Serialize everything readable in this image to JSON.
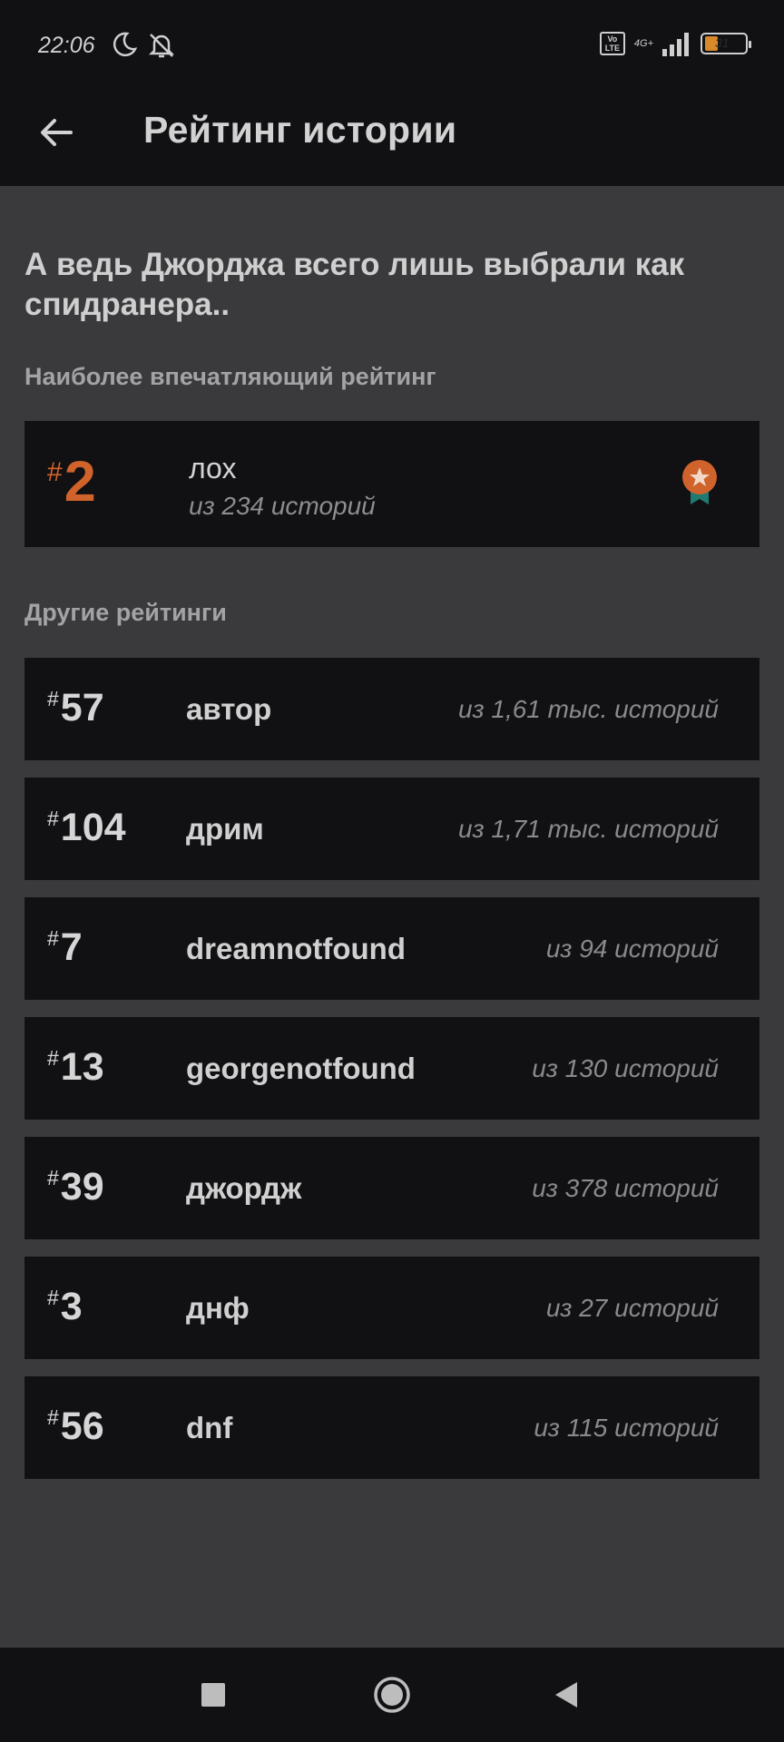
{
  "status_bar": {
    "time": "22:06",
    "volte_label": "Vo LTE",
    "network_label": "4G+",
    "battery_level": "31"
  },
  "app_bar": {
    "title": "Рейтинг истории"
  },
  "story": {
    "title": "А ведь Джорджа всего лишь выбрали как спидранера.."
  },
  "top_ranking": {
    "section_label": "Наиболее впечатляющий рейтинг",
    "hash": "#",
    "rank": "2",
    "tag": "лох",
    "count": "из 234 историй",
    "accent_color": "#d0632b"
  },
  "other_rankings": {
    "section_label": "Другие рейтинги",
    "items": [
      {
        "hash": "#",
        "rank": "57",
        "tag": "автор",
        "count": "из 1,61 тыс. историй"
      },
      {
        "hash": "#",
        "rank": "104",
        "tag": "дрим",
        "count": "из 1,71 тыс. историй"
      },
      {
        "hash": "#",
        "rank": "7",
        "tag": "dreamnotfound",
        "count": "из 94 историй"
      },
      {
        "hash": "#",
        "rank": "13",
        "tag": "georgenotfound",
        "count": "из 130 историй"
      },
      {
        "hash": "#",
        "rank": "39",
        "tag": "джордж",
        "count": "из 378 историй"
      },
      {
        "hash": "#",
        "rank": "3",
        "tag": "днф",
        "count": "из 27 историй"
      },
      {
        "hash": "#",
        "rank": "56",
        "tag": "dnf",
        "count": "из 115 историй"
      }
    ]
  },
  "nav_bar": {
    "buttons": [
      "recents-square-icon",
      "home-circle-icon",
      "back-triangle-icon"
    ]
  }
}
